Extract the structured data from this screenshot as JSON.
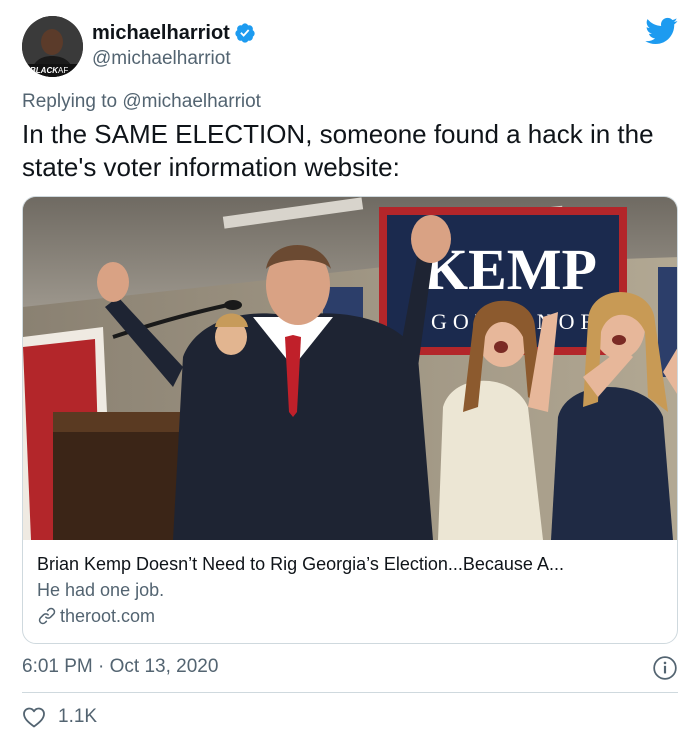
{
  "author": {
    "display_name": "michaelharriot",
    "handle": "@michaelharriot",
    "avatar_caption": "BLACK",
    "avatar_caption_suffix": "AF"
  },
  "reply": {
    "prefix": "Replying to ",
    "mention": "@michaelharriot"
  },
  "tweet": {
    "text": "In the SAME ELECTION, someone found a hack in the state's voter information website:"
  },
  "card": {
    "banner_text": "KEMP",
    "banner_subtext": "GOVERNOR",
    "title": "Brian Kemp Doesn’t Need to Rig Georgia’s Election...Because A...",
    "description": "He had one job.",
    "domain": "theroot.com"
  },
  "meta": {
    "timestamp": "6:01 PM · Oct 13, 2020"
  },
  "engagement": {
    "likes": "1.1K"
  },
  "colors": {
    "twitter_blue": "#1d9bf0",
    "secondary_text": "#536471",
    "border": "#cfd9de"
  },
  "icons": [
    "verified-badge-icon",
    "twitter-bird-icon",
    "link-icon",
    "info-icon",
    "heart-icon"
  ]
}
